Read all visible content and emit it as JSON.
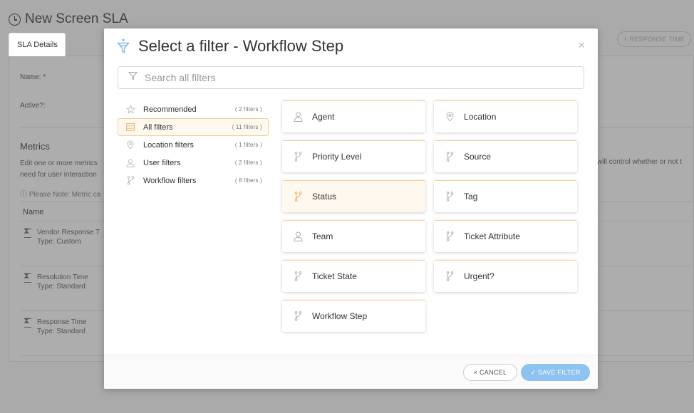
{
  "background": {
    "page_title": "New Screen SLA",
    "tab_label": "SLA Details",
    "response_time_button": "+ RESPONSE TIME",
    "name_label": "Name: *",
    "active_label": "Active?:",
    "metrics_heading": "Metrics",
    "metrics_text_line1": "Edit one or more metrics",
    "metrics_text_line2": "need for user interaction",
    "metrics_text_right": "will control whether or not t",
    "note_text": "ⓘ Please Note: Metric ca",
    "name_column_header": "Name",
    "metrics": [
      {
        "name": "Vendor Response T",
        "type": "Type: Custom"
      },
      {
        "name": "Resolution Time",
        "type": "Type: Standard"
      },
      {
        "name": "Response Time",
        "type": "Type: Standard"
      }
    ]
  },
  "modal": {
    "title": "Select a filter - Workflow Step",
    "close_icon": "×",
    "search": {
      "placeholder": "Search all filters",
      "value": ""
    },
    "categories": [
      {
        "label": "Recommended",
        "count": "( 2 filters )",
        "icon": "star-icon",
        "active": false
      },
      {
        "label": "All filters",
        "count": "( 11 filters )",
        "icon": "list-icon",
        "active": true
      },
      {
        "label": "Location filters",
        "count": "( 1 filters )",
        "icon": "location-pin-icon",
        "active": false
      },
      {
        "label": "User filters",
        "count": "( 2 filters )",
        "icon": "user-icon",
        "active": false
      },
      {
        "label": "Workflow filters",
        "count": "( 8 filters )",
        "icon": "workflow-icon",
        "active": false
      }
    ],
    "filters": [
      {
        "label": "Agent",
        "icon": "user-icon"
      },
      {
        "label": "Location",
        "icon": "location-pin-icon"
      },
      {
        "label": "Priority Level",
        "icon": "workflow-icon"
      },
      {
        "label": "Source",
        "icon": "workflow-icon"
      },
      {
        "label": "Status",
        "icon": "workflow-icon",
        "selected": true
      },
      {
        "label": "Tag",
        "icon": "workflow-icon"
      },
      {
        "label": "Team",
        "icon": "user-icon"
      },
      {
        "label": "Ticket Attribute",
        "icon": "workflow-icon"
      },
      {
        "label": "Ticket State",
        "icon": "workflow-icon"
      },
      {
        "label": "Urgent?",
        "icon": "workflow-icon"
      },
      {
        "label": "Workflow Step",
        "icon": "workflow-icon"
      }
    ],
    "cancel_label": "× CANCEL",
    "save_label": "✓ SAVE FILTER"
  },
  "colors": {
    "accent_orange": "#f5b553",
    "save_button_blue": "#8ec2f0",
    "selected_bg": "#fff8ee",
    "overlay": "rgba(80,80,80,0.47)"
  }
}
